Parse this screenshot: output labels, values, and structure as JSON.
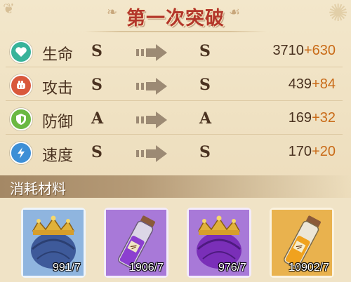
{
  "title": "第一次突破",
  "stats": [
    {
      "name": "生命",
      "icon": "heart-icon",
      "color": "#37b39a",
      "from_grade": "S",
      "to_grade": "S",
      "base": "3710",
      "bonus": "+630"
    },
    {
      "name": "攻击",
      "icon": "fist-icon",
      "color": "#d9583c",
      "from_grade": "S",
      "to_grade": "S",
      "base": "439",
      "bonus": "+84"
    },
    {
      "name": "防御",
      "icon": "shield-icon",
      "color": "#6ab843",
      "from_grade": "A",
      "to_grade": "A",
      "base": "169",
      "bonus": "+32"
    },
    {
      "name": "速度",
      "icon": "lightning-icon",
      "color": "#3d8fd6",
      "from_grade": "S",
      "to_grade": "S",
      "base": "170",
      "bonus": "+20"
    }
  ],
  "materials_title": "消耗材料",
  "materials": [
    {
      "item": "crown-blue",
      "rarity_color": "#7aa6d8",
      "count": "991/7"
    },
    {
      "item": "potion-purple",
      "rarity_color": "#9a6ad0",
      "count": "1906/7"
    },
    {
      "item": "crown-purple",
      "rarity_color": "#9a6ad0",
      "count": "976/7"
    },
    {
      "item": "potion-orange",
      "rarity_color": "#e3a63a",
      "count": "10902/7"
    }
  ]
}
